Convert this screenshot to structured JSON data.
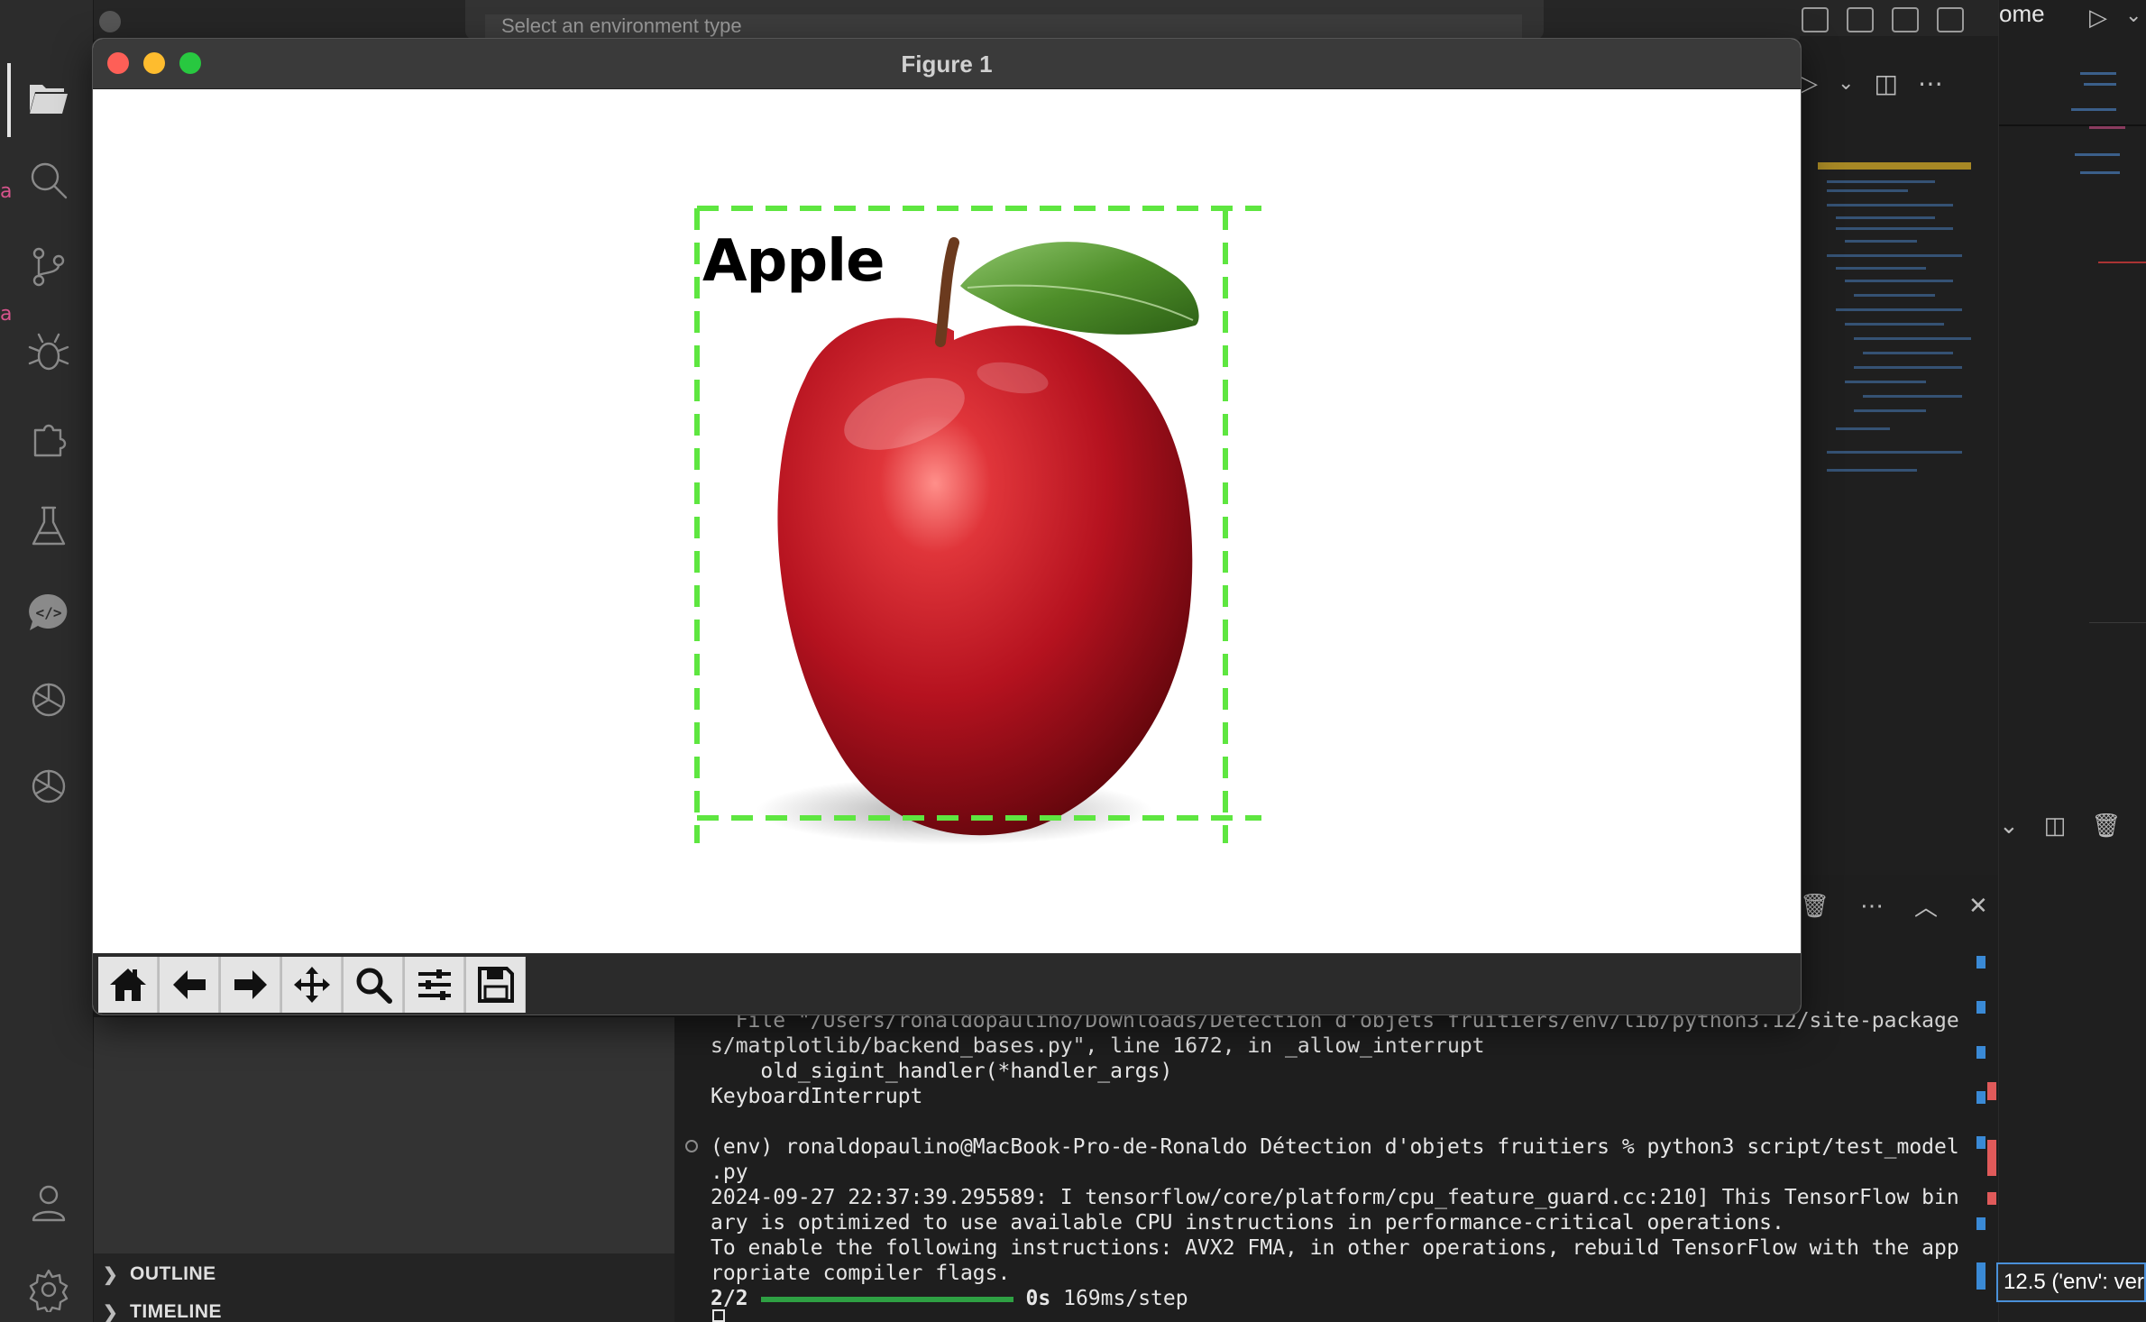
{
  "top_bar": {
    "command_center_placeholder": "Select an environment type",
    "right_clipped_text": "ome"
  },
  "figure": {
    "title": "Figure 1",
    "detection_label": "Apple",
    "box_color": "#5ee640",
    "toolbar_buttons": [
      "home-icon",
      "back-arrow-icon",
      "forward-arrow-icon",
      "pan-icon",
      "zoom-icon",
      "configure-subplots-icon",
      "save-icon"
    ]
  },
  "explorer": {
    "sections": [
      {
        "label": "OUTLINE"
      },
      {
        "label": "TIMELINE"
      }
    ]
  },
  "terminal": {
    "lines": [
      "  File \"/Users/ronaldopaulino/Downloads/Détection d'objets fruitiers/env/lib/python3.12/site-package",
      "s/matplotlib/backend_bases.py\", line 1672, in _allow_interrupt",
      "    old_sigint_handler(*handler_args)",
      "KeyboardInterrupt",
      "",
      "(env) ronaldopaulino@MacBook-Pro-de-Ronaldo Détection d'objets fruitiers % python3 script/test_model",
      ".py",
      "2024-09-27 22:37:39.295589: I tensorflow/core/platform/cpu_feature_guard.cc:210] This TensorFlow bin",
      "ary is optimized to use available CPU instructions in performance-critical operations.",
      "To enable the following instructions: AVX2 FMA, in other operations, rebuild TensorFlow with the app",
      "ropriate compiler flags."
    ],
    "progress": {
      "step": "2/2",
      "fraction": 1.0,
      "time": "0s",
      "rate": "169ms/step"
    }
  },
  "status": {
    "python_env": "12.5 ('env': ver"
  },
  "colors": {
    "accent_blue": "#4a90d9",
    "progress_green": "#2ea043"
  }
}
